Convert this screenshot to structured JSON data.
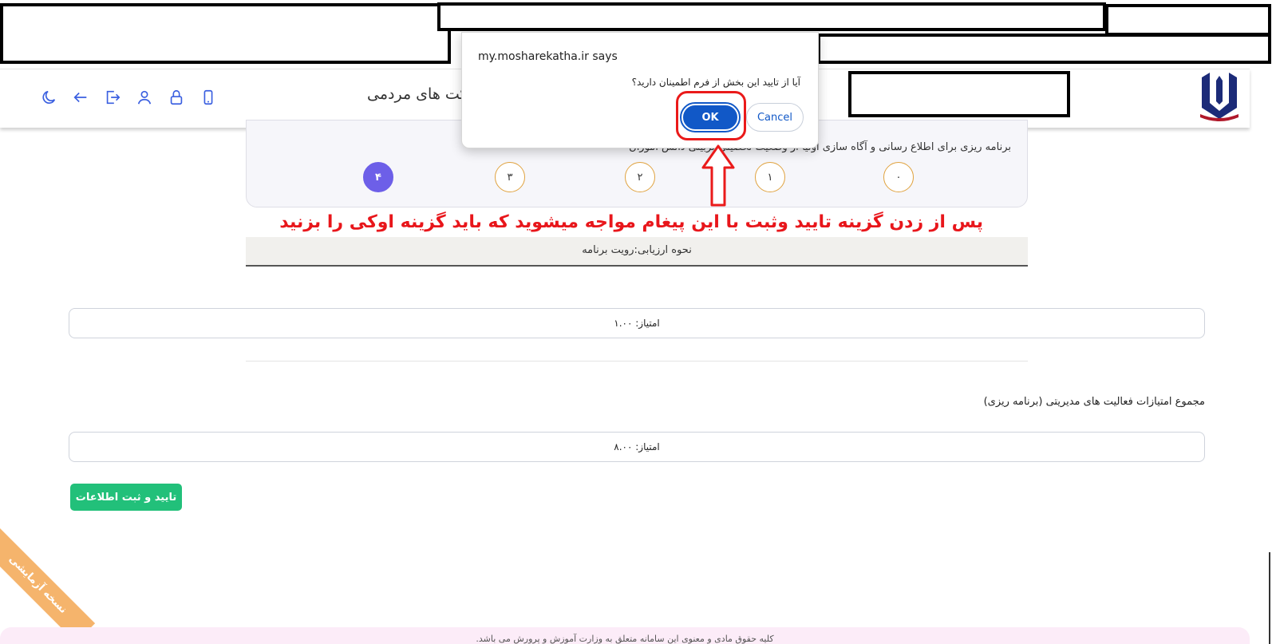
{
  "dialog": {
    "title": "my.mosharekatha.ir says",
    "message": "آیا از تایید این بخش از فرم اطمینان دارید؟",
    "ok_label": "OK",
    "cancel_label": "Cancel"
  },
  "header": {
    "title_partial": "کت های مردمی",
    "icons": [
      "moon-icon",
      "arrow-left-icon",
      "logout-icon",
      "user-icon",
      "lock-icon",
      "mobile-icon"
    ]
  },
  "question": {
    "text": "برنامه ریزی برای اطلاع رسانی و آگاه سازی اولیا از وضعیت تحصیلی تربیتی دانش آموزان",
    "options": [
      "۰",
      "۱",
      "۲",
      "۳",
      "۴"
    ],
    "selected": "۴"
  },
  "annotation": "پس از زدن گزینه تایید وثبت با این پیغام مواجه میشوید که باید گزینه اوکی را بزنید",
  "evaluation": "نحوه ارزیابی:رویت برنامه",
  "score_1": "امتیاز: ۱.۰۰",
  "sum_label": "مجموع امتیازات فعالیت های مدیریتی (برنامه ریزی)",
  "score_total": "امتیاز: ۸.۰۰",
  "submit_label": "تایید و ثبت اطلاعات",
  "footer": "کلیه حقوق مادی و معنوی این سامانه متعلق به وزارت آموزش و پرورش می باشد.",
  "ribbon": "نسخه آزمایشی",
  "colors": {
    "accent": "#3a5fe0",
    "selected_option": "#6d5fe8",
    "option_border": "#e0a340",
    "submit": "#22c07a",
    "annotation": "#e8161b",
    "ok_button": "#1158c7"
  }
}
